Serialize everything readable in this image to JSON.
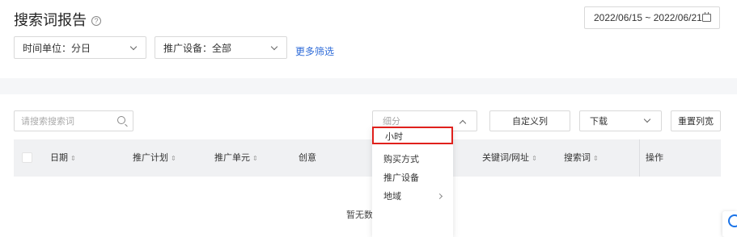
{
  "page": {
    "title": "搜索词报告",
    "help_icon": "?"
  },
  "date_range": {
    "value": "2022/06/15 ~ 2022/06/21"
  },
  "filters": {
    "time_unit": "时间单位：分日",
    "device": "推广设备：全部",
    "more": "更多筛选"
  },
  "toolbar": {
    "search_placeholder": "请搜索搜索词",
    "segment_label": "细分",
    "custom_columns": "自定义列",
    "download": "下载",
    "reset_width": "重置列宽"
  },
  "table": {
    "columns": [
      "日期",
      "推广计划",
      "推广单元",
      "创意",
      "关键词/网址",
      "搜索词",
      "操作"
    ],
    "sort_glyph": "⇕",
    "empty_text": "暂无数"
  },
  "segment_menu": {
    "items": [
      "小时",
      "购买方式",
      "推广设备",
      "地域"
    ],
    "highlighted": "小时",
    "highlight_color": "#e0201c"
  },
  "colors": {
    "link": "#2e6bd8",
    "header_bg": "#f0f1f3",
    "band_bg": "#f5f6f8"
  }
}
